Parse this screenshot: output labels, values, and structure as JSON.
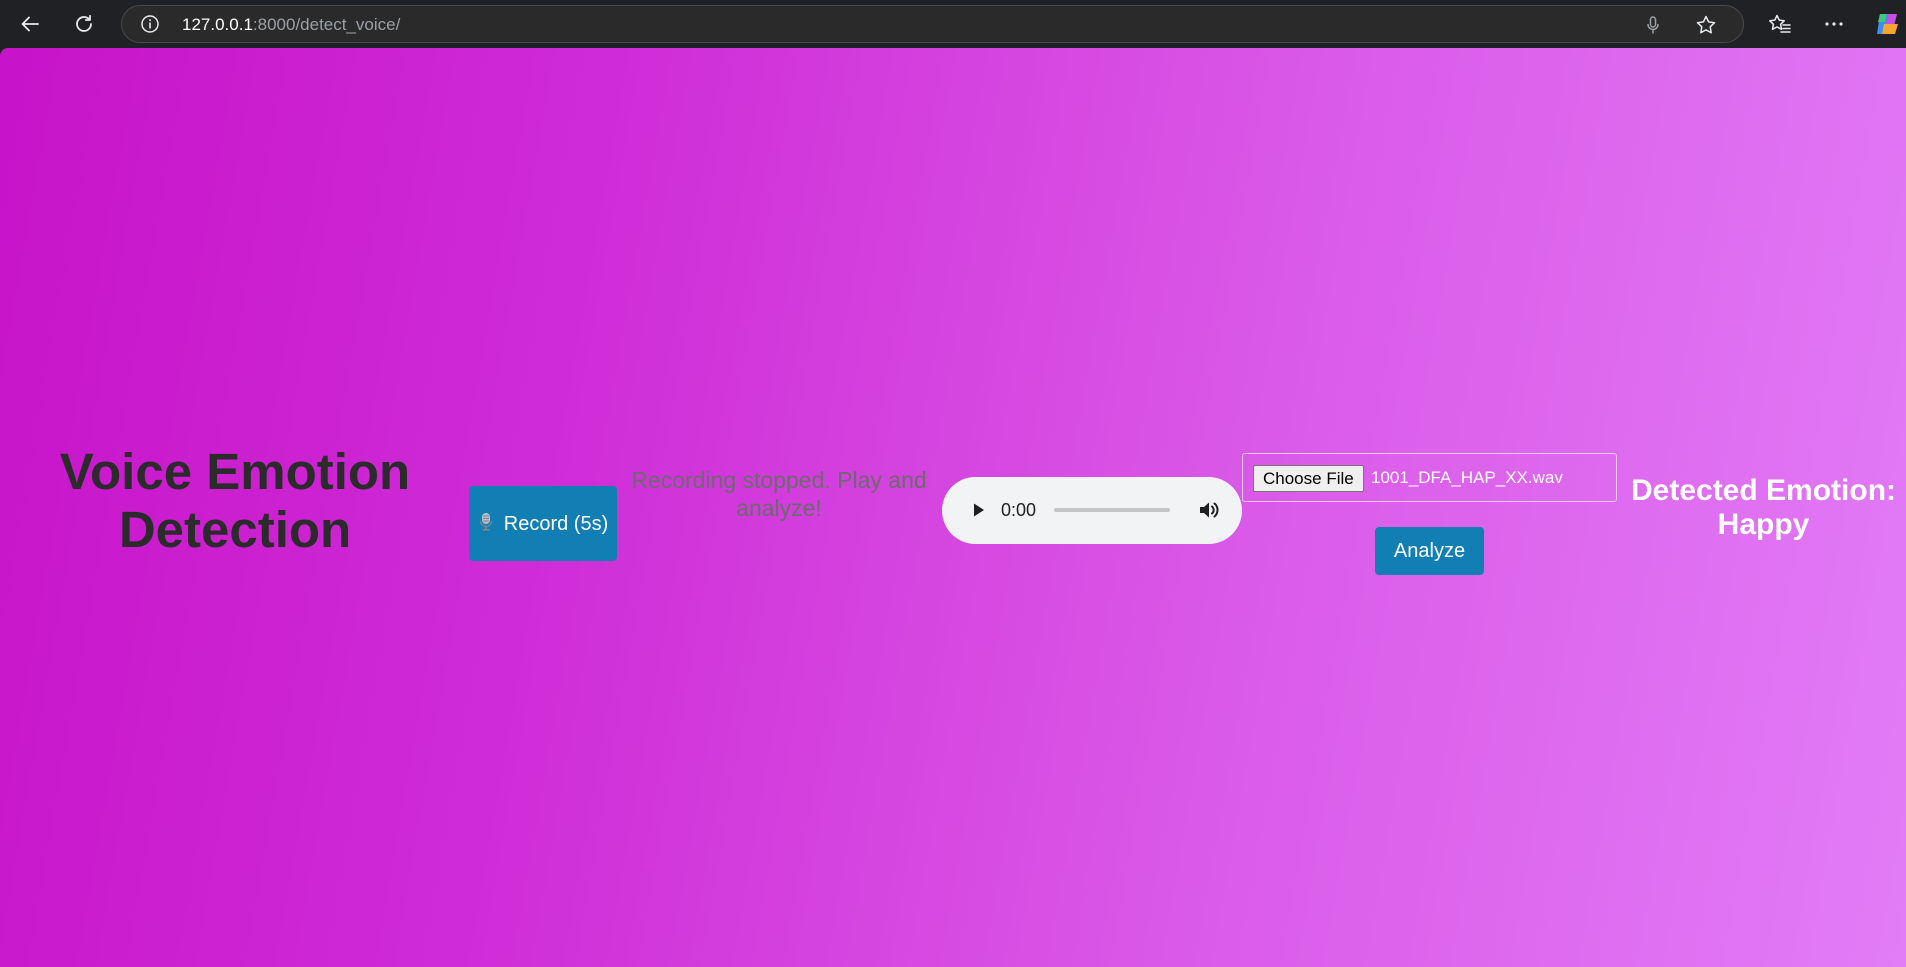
{
  "browser": {
    "url_host": "127.0.0.1",
    "url_rest": ":8000/detect_voice/"
  },
  "page": {
    "title": "Voice Emotion Detection",
    "record_button": {
      "icon": "microphone",
      "label": "Record (5s)"
    },
    "status": "Recording stopped. Play and analyze!",
    "audio_player": {
      "current_time": "0:00",
      "progress": 0
    },
    "file_input": {
      "button_label": "Choose File",
      "file_name": "1001_DFA_HAP_XX.wav"
    },
    "analyze_button": "Analyze",
    "result": "Detected Emotion: Happy"
  },
  "colors": {
    "background_gradient_start": "#c713c9",
    "background_gradient_end": "#e27cf7",
    "button_blue": "#117fb3",
    "title_text": "#2b2b2b",
    "status_text": "#6b6b6b"
  }
}
